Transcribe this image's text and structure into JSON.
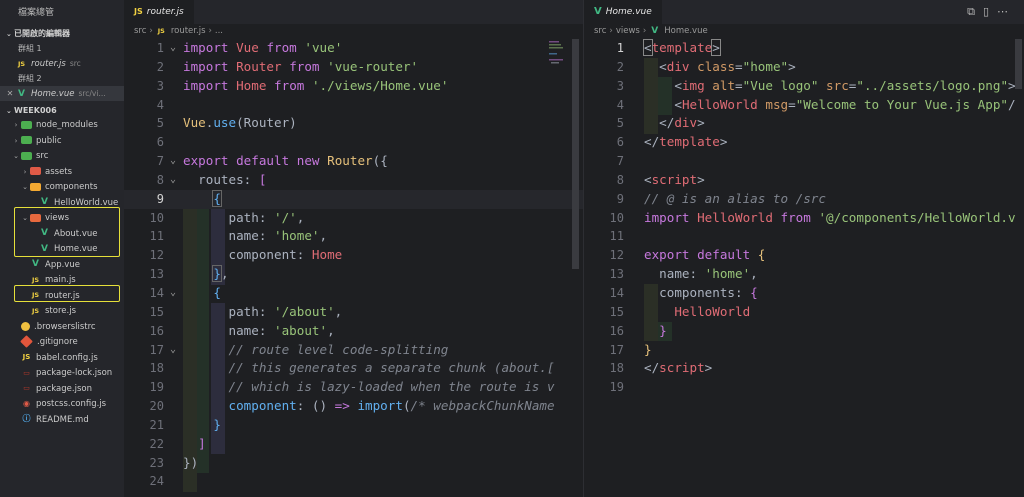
{
  "sidebar": {
    "title": "檔案總管",
    "open_editors_label": "已開啟的編輯器",
    "group1_label": "群組 1",
    "group2_label": "群組 2",
    "open_editors": [
      {
        "name": "router.js",
        "sub": "src",
        "icon": "js"
      },
      {
        "name": "Home.vue",
        "sub": "src/vi...",
        "icon": "vue"
      }
    ],
    "project_label": "WEEK006",
    "tree": [
      {
        "name": "node_modules",
        "icon": "folder-green",
        "chev": "›",
        "indent": 1
      },
      {
        "name": "public",
        "icon": "folder-green",
        "chev": "›",
        "indent": 1
      },
      {
        "name": "src",
        "icon": "folder-green",
        "chev": "⌄",
        "indent": 1
      },
      {
        "name": "assets",
        "icon": "folder-red",
        "chev": "›",
        "indent": 2
      },
      {
        "name": "components",
        "icon": "folder-orange",
        "chev": "⌄",
        "indent": 2
      },
      {
        "name": "HelloWorld.vue",
        "icon": "vue",
        "chev": "",
        "indent": 3
      },
      {
        "name": "views",
        "icon": "folder-vue",
        "chev": "⌄",
        "indent": 2
      },
      {
        "name": "About.vue",
        "icon": "vue",
        "chev": "",
        "indent": 3
      },
      {
        "name": "Home.vue",
        "icon": "vue",
        "chev": "",
        "indent": 3
      },
      {
        "name": "App.vue",
        "icon": "vue",
        "chev": "",
        "indent": 2
      },
      {
        "name": "main.js",
        "icon": "js",
        "chev": "",
        "indent": 2
      },
      {
        "name": "router.js",
        "icon": "js",
        "chev": "",
        "indent": 2
      },
      {
        "name": "store.js",
        "icon": "js",
        "chev": "",
        "indent": 2
      },
      {
        "name": ".browserslistrc",
        "icon": "circle",
        "chev": "",
        "indent": 1
      },
      {
        "name": ".gitignore",
        "icon": "git",
        "chev": "",
        "indent": 1
      },
      {
        "name": "babel.config.js",
        "icon": "babel",
        "chev": "",
        "indent": 1
      },
      {
        "name": "package-lock.json",
        "icon": "json",
        "chev": "",
        "indent": 1
      },
      {
        "name": "package.json",
        "icon": "json",
        "chev": "",
        "indent": 1
      },
      {
        "name": "postcss.config.js",
        "icon": "postcss",
        "chev": "",
        "indent": 1
      },
      {
        "name": "README.md",
        "icon": "md",
        "chev": "",
        "indent": 1
      }
    ]
  },
  "editor_left": {
    "tab_label": "router.js",
    "tab_icon": "JS",
    "breadcrumb": [
      "src",
      "router.js",
      "..."
    ],
    "cursor_line": 9
  },
  "editor_right": {
    "tab_label": "Home.vue",
    "breadcrumb": [
      "src",
      "views",
      "Home.vue"
    ],
    "cursor_line": 1
  },
  "colors": {
    "highlight_box": "#e6e03a",
    "accent_vue": "#41b883",
    "js_yellow": "#f1d142"
  }
}
